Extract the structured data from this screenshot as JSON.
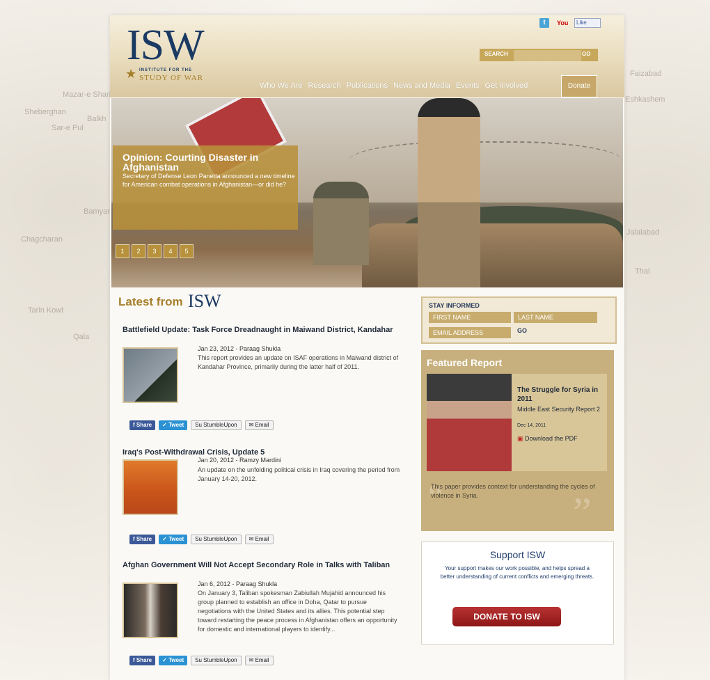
{
  "background_map_labels": [
    "Balkh",
    "Sar-e Pul",
    "Mazar-e Sharif",
    "Sheberghan",
    "Bamyan",
    "Chagcharan",
    "Qala",
    "Tarin Kowt",
    "Jalalabad",
    "Faizabad",
    "Eshkashem",
    "Thal"
  ],
  "header": {
    "logo": "ISW",
    "logo_sub1": "INSTITUTE FOR THE",
    "logo_sub2": "STUDY OF WAR",
    "social": {
      "twitter": "t",
      "youtube": "You",
      "facebook_like": "Like"
    },
    "search": {
      "label": "SEARCH",
      "placeholder": "",
      "go": "GO"
    },
    "nav": [
      "Who We Are",
      "Research",
      "Publications",
      "News and Media",
      "Events",
      "Get Involved"
    ],
    "donate": "Donate"
  },
  "hero": {
    "title": "Opinion: Courting Disaster in Afghanistan",
    "description": "Secretary of Defense Leon Panetta announced a new timeline for American combat operations in Afghanistan—or did he?",
    "pages": [
      "1",
      "2",
      "3",
      "4",
      "5"
    ]
  },
  "latest": {
    "heading": "Latest from",
    "logo": "ISW",
    "share_labels": {
      "facebook": "Share",
      "twitter": "Tweet",
      "stumble": "StumbleUpon",
      "email": "Email"
    },
    "articles": [
      {
        "title": "Battlefield Update: Task Force Dreadnaught in Maiwand District, Kandahar",
        "meta": "Jan 23, 2012 - Paraag Shukla",
        "desc": "This report provides an update on ISAF operations in Maiwand district of Kandahar Province, primarily during the latter half of 2011."
      },
      {
        "title": "Iraq's Post-Withdrawal Crisis, Update 5",
        "meta": "Jan 20, 2012 - Ramzy Mardini",
        "desc": "An update on the unfolding political crisis in Iraq covering the period from January 14-20, 2012."
      },
      {
        "title": "Afghan Government Will Not Accept Secondary Role in Talks with Taliban",
        "meta": "Jan 6, 2012 - Paraag Shukla",
        "desc": "On January 3, Taliban spokesman Zabiullah Mujahid announced his group planned to establish an office in Doha, Qatar to pursue negotiations with the United States and its allies. This potential step toward restarting the peace process in Afghanistan offers an opportunity for domestic and international players to identify..."
      }
    ]
  },
  "stay_informed": {
    "label": "STAY INFORMED",
    "first_name": "FIRST NAME",
    "last_name": "LAST NAME",
    "email": "EMAIL ADDRESS",
    "go": "GO"
  },
  "featured": {
    "heading": "Featured Report",
    "title": "The Struggle for Syria in 2011",
    "subtitle": "Middle East Security Report 2",
    "date": "Dec 14, 2011",
    "pdf": "Download the PDF",
    "text": "This paper provides context for understanding the cycles of violence in Syria."
  },
  "support": {
    "heading": "Support ISW",
    "text": "Your support makes our work possible, and helps spread a better understanding of current conflicts and emerging threats.",
    "button": "DONATE TO ISW"
  },
  "colors": {
    "gold": "#b7913b",
    "navy": "#1b3a63",
    "red": "#a51f1f"
  }
}
